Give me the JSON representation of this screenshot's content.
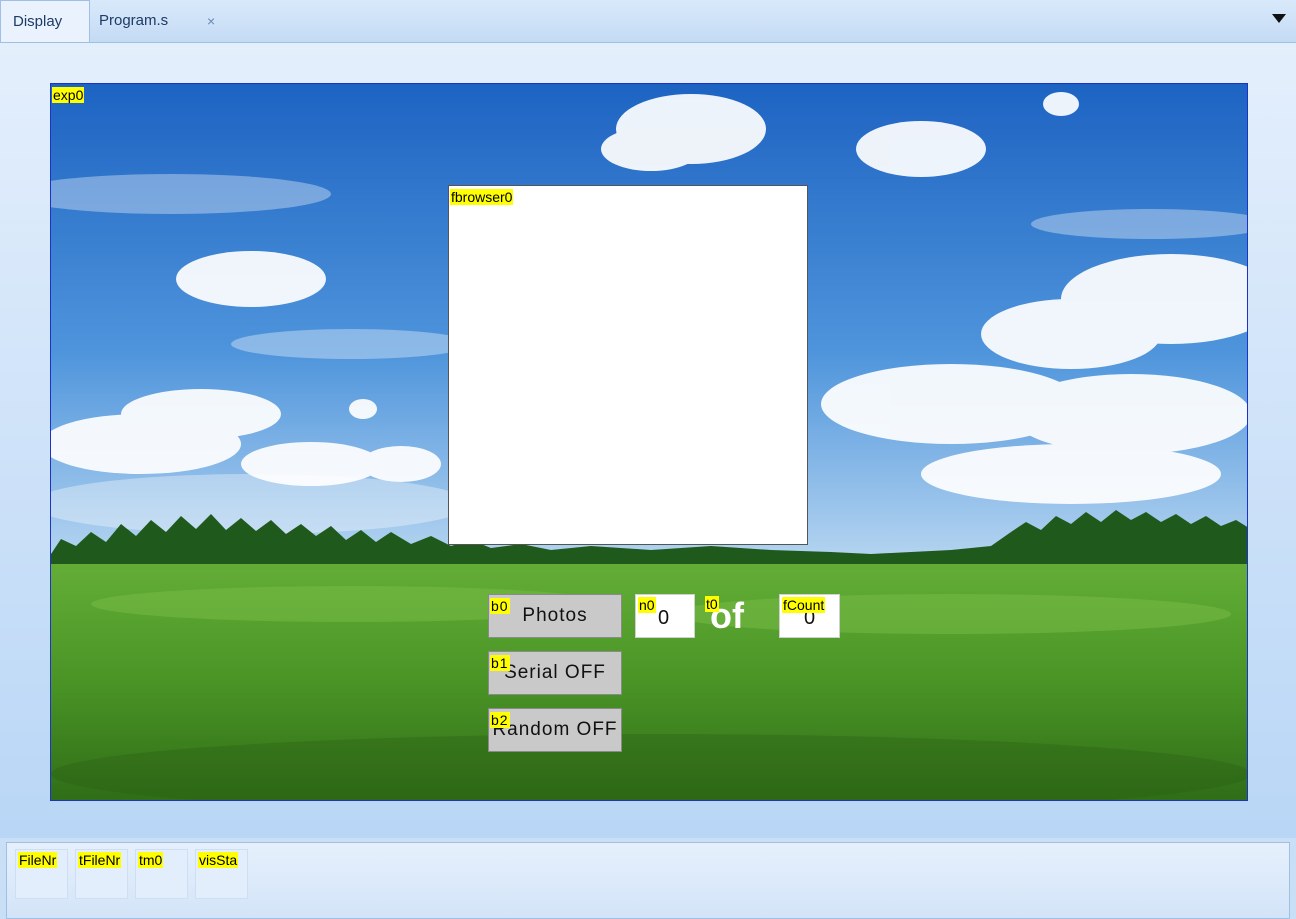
{
  "tabs": {
    "display": "Display",
    "program": "Program.s",
    "close_glyph": "×"
  },
  "canvas": {
    "picture_tag": "exp0",
    "fbrowser_tag": "fbrowser0"
  },
  "buttons": {
    "b0": {
      "tag": "b0",
      "label": "Photos"
    },
    "b1": {
      "tag": "b1",
      "label": "Serial OFF"
    },
    "b2": {
      "tag": "b2",
      "label": "Random OFF"
    }
  },
  "counter": {
    "n0_tag": "n0",
    "n0_value": "0",
    "t0_tag": "t0",
    "t0_text": "of",
    "fcount_tag": "fCount",
    "fcount_value": "0"
  },
  "components": [
    {
      "tag": "FileNr"
    },
    {
      "tag": "tFileNr"
    },
    {
      "tag": "tm0"
    },
    {
      "tag": "visSta"
    }
  ],
  "colors": {
    "tag_background": "#ffff00",
    "canvas_border": "#1c33c8",
    "sky": "#3f86d4",
    "grass": "#4f9a2a"
  }
}
